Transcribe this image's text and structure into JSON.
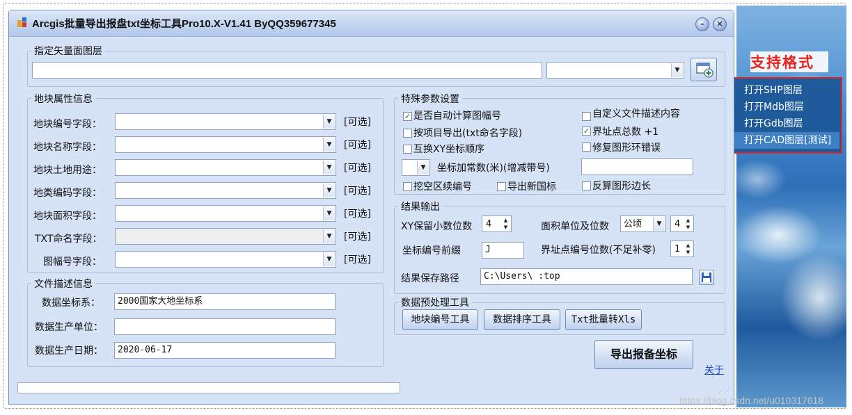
{
  "window": {
    "title": "Arcgis批量导出报盘txt坐标工具Pro10.X-V1.41 ByQQ359677345",
    "minimize": "–",
    "close": "×"
  },
  "side": {
    "support_label": "支持格式",
    "menu": [
      "打开SHP图层",
      "打开Mdb图层",
      "打开Gdb图层",
      "打开CAD图层[测试]"
    ]
  },
  "vector_layer": {
    "title": "指定矢量面图层",
    "path": "",
    "combo": ""
  },
  "attributes": {
    "title": "地块属性信息",
    "optional_label": "[可选]",
    "fields": [
      {
        "label": "地块编号字段：",
        "value": ""
      },
      {
        "label": "地块名称字段：",
        "value": ""
      },
      {
        "label": "地块土地用途：",
        "value": ""
      },
      {
        "label": "地类编码字段：",
        "value": ""
      },
      {
        "label": "地块面积字段：",
        "value": ""
      },
      {
        "label": "TXT命名字段：",
        "value": ""
      },
      {
        "label": "图幅号字段：",
        "value": ""
      }
    ]
  },
  "file_desc": {
    "title": "文件描述信息",
    "coord_label": "数据坐标系：",
    "coord_value": "2000国家大地坐标系",
    "unit_label": "数据生产单位：",
    "unit_value": "",
    "date_label": "数据生产日期：",
    "date_value": "2020-06-17"
  },
  "special": {
    "title": "特殊参数设置",
    "auto_sheet": {
      "label": "是否自动计算图幅号",
      "checked": true
    },
    "custom_desc": {
      "label": "自定义文件描述内容",
      "checked": false
    },
    "export_by_item": {
      "label": "按项目导出(txt命名字段)",
      "checked": false
    },
    "boundary_count": {
      "label": "界址点总数 +1",
      "checked": true
    },
    "swap_xy": {
      "label": "互换XY坐标顺序",
      "checked": false
    },
    "fix_ring": {
      "label": "修复图形环错误",
      "checked": false
    },
    "const_combo": "",
    "const_label": "坐标加常数(米)(增减带号)",
    "const_value": "",
    "hole_renumber": {
      "label": "挖空区续编号",
      "checked": false
    },
    "new_std": {
      "label": "导出新国标",
      "checked": false
    },
    "back_calc": {
      "label": "反算图形边长",
      "checked": false
    }
  },
  "output": {
    "title": "结果输出",
    "xy_decimals_label": "XY保留小数位数",
    "xy_decimals_value": "4",
    "area_unit_label": "面积单位及位数",
    "area_unit_value": "公顷",
    "area_decimals_value": "4",
    "prefix_label": "坐标编号前缀",
    "prefix_value": "J",
    "point_digits_label": "界址点编号位数(不足补零)",
    "point_digits_value": "1",
    "save_path_label": "结果保存路径",
    "save_path_value": "C:\\Users\\           :top"
  },
  "preprocess": {
    "title": "数据预处理工具",
    "buttons": [
      "地块编号工具",
      "数据排序工具",
      "Txt批量转Xls"
    ]
  },
  "export_button": "导出报备坐标",
  "about_link": "关于",
  "watermark": "https://blog.csdn.net/u010317618"
}
